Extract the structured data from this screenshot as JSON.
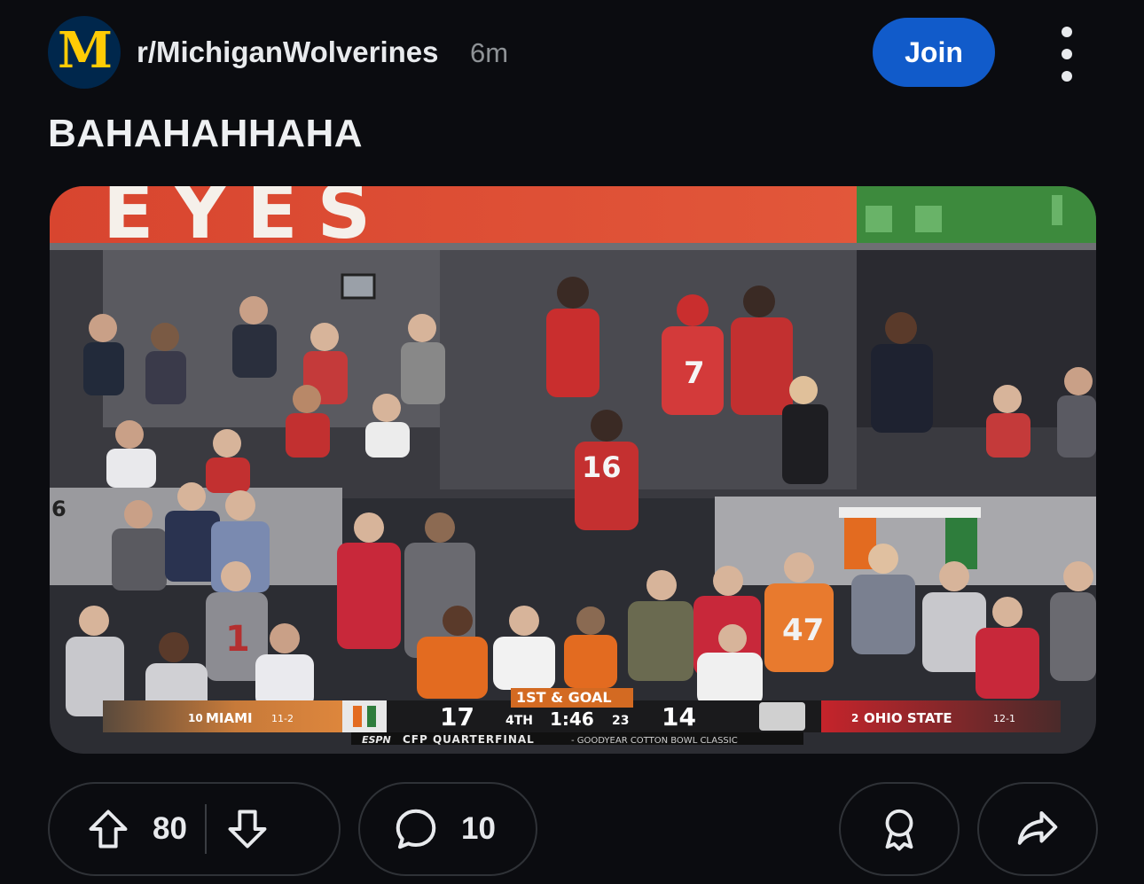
{
  "post": {
    "subreddit": "r/MichiganWolverines",
    "age": "6m",
    "avatar_letter": "M",
    "join_label": "Join",
    "title": "BAHAHAHHAHA"
  },
  "media": {
    "banner_text": "EYES",
    "section_number": "6",
    "jersey_numbers": [
      "7",
      "16",
      "47",
      "1"
    ],
    "scorebug": {
      "away_rank": "10",
      "away_team": "MIAMI",
      "away_record": "11-2",
      "away_score": "17",
      "down_distance": "1ST & GOAL",
      "quarter": "4TH",
      "clock": "1:46",
      "play_clock": "23",
      "home_score": "14",
      "home_rank": "2",
      "home_team": "OHIO STATE",
      "home_record": "12-1",
      "network": "ESPN",
      "event": "CFP QUARTERFINAL",
      "sponsor": "- GOODYEAR COTTON BOWL CLASSIC"
    }
  },
  "actions": {
    "upvotes": "80",
    "comments": "10"
  },
  "colors": {
    "join": "#115bca",
    "michigan_blue": "#00274c",
    "michigan_maize": "#ffcb05",
    "miami_orange": "#f47321",
    "osu_scarlet": "#bb0000"
  }
}
